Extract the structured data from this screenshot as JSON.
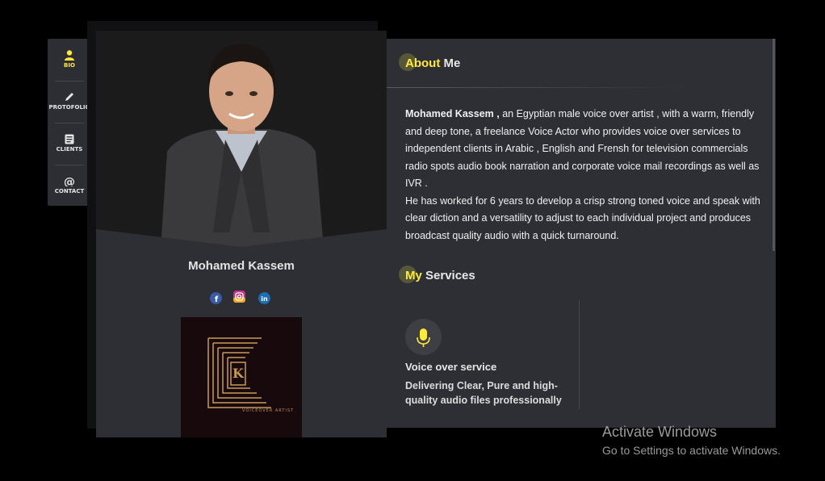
{
  "nav": {
    "items": [
      {
        "label": "BIO",
        "icon": "person-icon",
        "active": true
      },
      {
        "label": "PROTOFOLIO",
        "icon": "pencil-icon",
        "active": false
      },
      {
        "label": "CLIENTS",
        "icon": "list-icon",
        "active": false
      },
      {
        "label": "CONTACT",
        "icon": "at-icon",
        "active": false
      }
    ]
  },
  "profile": {
    "name": "Mohamed Kassem",
    "socials": [
      "facebook-icon",
      "instagram-icon",
      "linkedin-icon"
    ],
    "logo_letter": "K",
    "logo_caption": "VOICEOVER ARTIST"
  },
  "about": {
    "heading_highlight": "About",
    "heading_rest": " Me",
    "name_bold": "Mohamed Kassem ,",
    "paragraph1": " an Egyptian male voice over artist , with a warm, friendly and deep tone, a freelance Voice Actor who provides voice over services to independent clients in Arabic , English and Frensh for television commercials radio spots audio book narration and corporate voice mail recordings as well as IVR .",
    "paragraph2": "He has worked for 6 years to develop a crisp strong toned voice and speak with clear diction and a versatility to adjust to each individual project and produces broadcast quality audio with a quick turnaround."
  },
  "services": {
    "heading_highlight": "My",
    "heading_rest": " Services",
    "items": [
      {
        "icon": "microphone-icon",
        "title": "Voice over service",
        "description": "Delivering Clear, Pure and high-quality audio files professionally edited and mastered"
      }
    ]
  },
  "watermark": {
    "title": "Activate Windows",
    "subtitle": "Go to Settings to activate Windows."
  },
  "colors": {
    "accent": "#ffea3b",
    "panel": "#2e2f35",
    "background": "#000000"
  }
}
